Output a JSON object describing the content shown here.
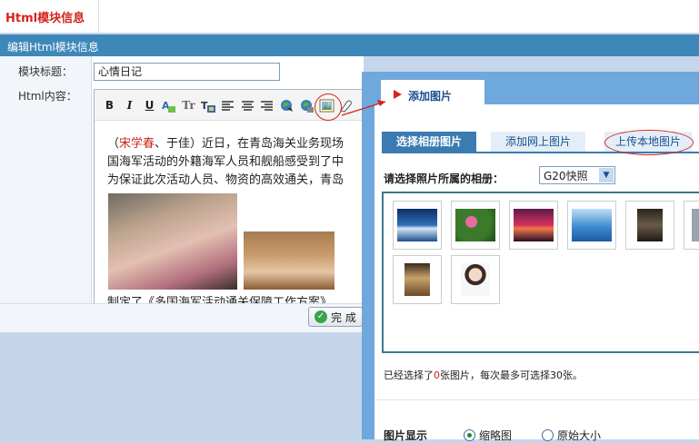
{
  "page": {
    "title": "Html模块信息"
  },
  "panel": {
    "header": "编辑Html模块信息"
  },
  "form": {
    "title_label": "模块标题：",
    "title_value": "心情日记",
    "content_label": "Html内容："
  },
  "toolbar": {
    "bold": "B",
    "italic": "I",
    "underline": "U",
    "tr": "Tr"
  },
  "editor": {
    "line1_prefix": "（",
    "line1_name": "宋学春",
    "line1_rest": "、于佳）近日，在青岛海关业务现场",
    "line2": "国海军活动的外籍海军人员和舰船感受到了中",
    "line3": "为保证此次活动人员、物资的高效通关，青岛",
    "line4": "制定了《多国海军活动通关保障工作方案》"
  },
  "buttons": {
    "finish": "完 成"
  },
  "dialog": {
    "tab_label": "添加图片",
    "subtabs": [
      "选择相册图片",
      "添加网上图片",
      "上传本地图片"
    ],
    "album_label": "请选择照片所属的相册：",
    "album_value": "G20快照",
    "selected_prefix": "已经选择了",
    "selected_count": "0",
    "selected_suffix": "张图片，每次最多可选择30张。",
    "display_label": "图片显示",
    "radio_thumb": "缩略图",
    "radio_original": "原始大小"
  }
}
